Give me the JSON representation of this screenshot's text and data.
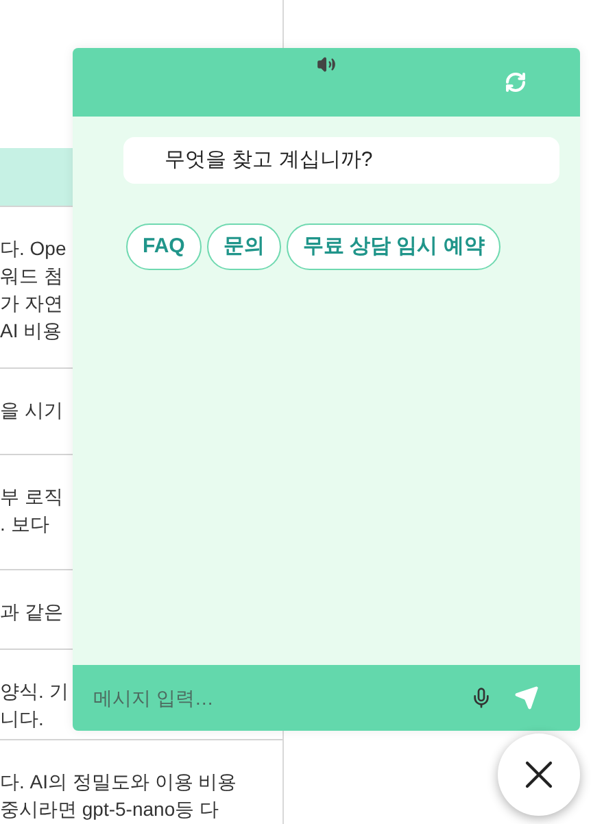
{
  "page_table": {
    "rows": [
      {
        "lines": [
          "다. Ope",
          "워드 첨",
          "가 자연",
          "AI 비용"
        ]
      },
      {
        "lines": [
          "을 시기"
        ]
      },
      {
        "lines": [
          "부 로직",
          ". 보다"
        ]
      },
      {
        "lines": [
          "과 같은"
        ]
      },
      {
        "lines": [
          "양식. 기",
          "니다."
        ]
      },
      {
        "lines": [
          "다. AI의 정밀도와 이용 비용",
          "중시라면 gpt-5-nano등 다"
        ]
      }
    ]
  },
  "chat": {
    "greeting": "무엇을 찾고 계십니까?",
    "quick_replies": [
      {
        "label": "FAQ"
      },
      {
        "label": "문의"
      },
      {
        "label": "무료 상담 임시 예약"
      }
    ],
    "input": {
      "placeholder": "메시지 입력…"
    }
  }
}
